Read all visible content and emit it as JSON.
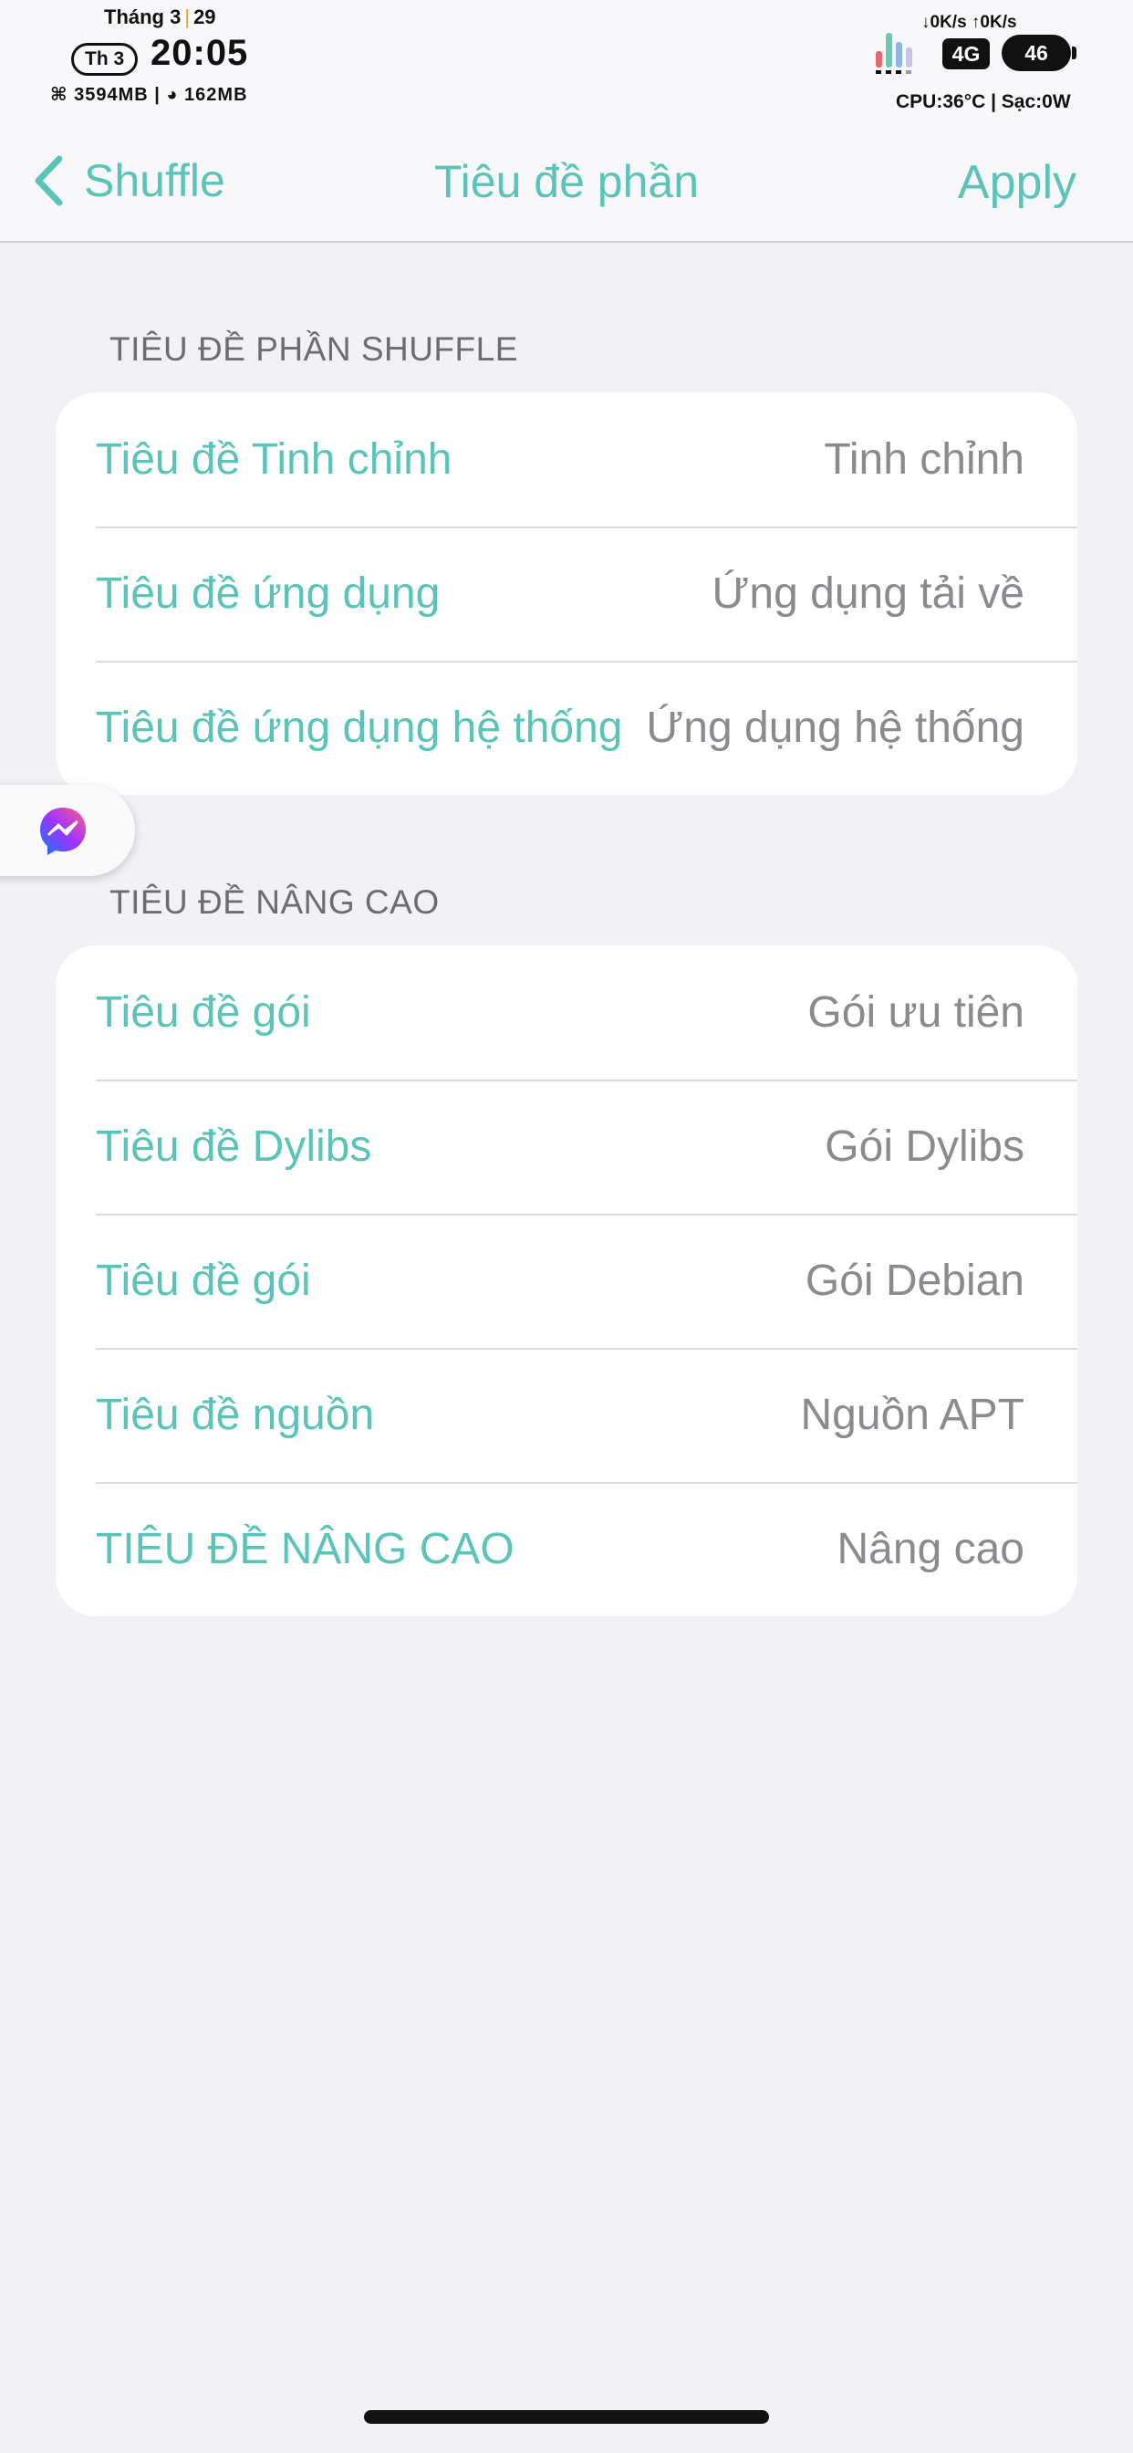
{
  "status_bar": {
    "month": "Tháng 3",
    "day": "29",
    "weekday": "Th 3",
    "time": "20:05",
    "memory": "⌘ 3594MB | ◕ 162MB",
    "net_speed": "↓0K/s ↑0K/s",
    "network": "4G",
    "battery": "46",
    "cpu_info": "CPU:36°C | Sạc:0W"
  },
  "nav": {
    "back_label": "Shuffle",
    "title": "Tiêu đề phần",
    "apply_label": "Apply"
  },
  "sections": [
    {
      "header": "TIÊU ĐỀ PHẦN SHUFFLE",
      "rows": [
        {
          "label": "Tiêu đề Tinh chỉnh",
          "value": "Tinh chỉnh"
        },
        {
          "label": "Tiêu đề ứng dụng",
          "value": "Ứng dụng tải về"
        },
        {
          "label": "Tiêu đề ứng dụng hệ thống",
          "value": "Ứng dụng hệ thống"
        }
      ]
    },
    {
      "header": "TIÊU ĐỀ NÂNG CAO",
      "rows": [
        {
          "label": "Tiêu đề gói",
          "value": "Gói ưu tiên"
        },
        {
          "label": "Tiêu đề Dylibs",
          "value": "Gói Dylibs"
        },
        {
          "label": "Tiêu đề gói",
          "value": "Gói Debian"
        },
        {
          "label": "Tiêu đề nguồn",
          "value": "Nguồn APT"
        },
        {
          "label": "TIÊU ĐỀ NÂNG CAO",
          "value": "Nâng cao"
        }
      ]
    }
  ],
  "floating_button_icon": "messenger-icon",
  "colors": {
    "accent": "#5bc4b8",
    "value_text": "#8a8a8f",
    "background": "#f1f1f6"
  }
}
